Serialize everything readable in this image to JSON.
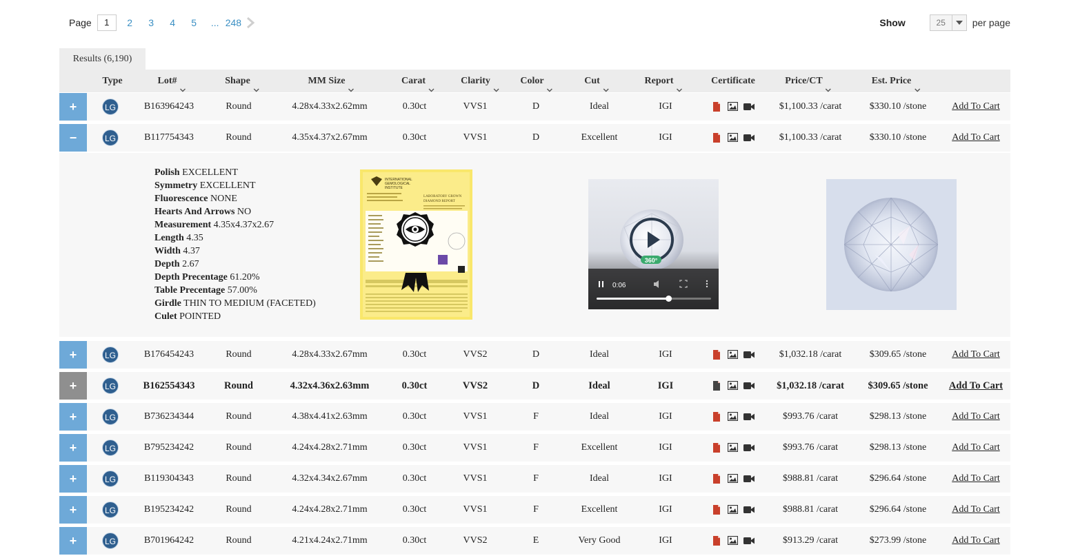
{
  "pagination": {
    "label": "Page",
    "current": "1",
    "pages": [
      "2",
      "3",
      "4",
      "5"
    ],
    "ellipsis": "...",
    "last": "248"
  },
  "show": {
    "label": "Show",
    "value": "25",
    "suffix": "per page"
  },
  "results_tab": "Results (6,190)",
  "columns": {
    "type": "Type",
    "lot": "Lot#",
    "shape": "Shape",
    "mm": "MM Size",
    "carat": "Carat",
    "clarity": "Clarity",
    "color": "Color",
    "cut": "Cut",
    "report": "Report",
    "certificate": "Certificate",
    "price_ct": "Price/CT",
    "est_price": "Est. Price"
  },
  "type_badge": "LG",
  "add_to_cart": "Add To Cart",
  "rows": [
    {
      "toggle": "+",
      "lot": "B163964243",
      "shape": "Round",
      "mm": "4.28x4.33x2.62mm",
      "carat": "0.30ct",
      "clarity": "VVS1",
      "color": "D",
      "cut": "Ideal",
      "report": "IGI",
      "price_ct": "$1,100.33 /carat",
      "est_price": "$330.10 /stone"
    },
    {
      "toggle": "−",
      "lot": "B117754343",
      "shape": "Round",
      "mm": "4.35x4.37x2.67mm",
      "carat": "0.30ct",
      "clarity": "VVS1",
      "color": "D",
      "cut": "Excellent",
      "report": "IGI",
      "price_ct": "$1,100.33 /carat",
      "est_price": "$330.10 /stone"
    },
    {
      "toggle": "+",
      "lot": "B176454243",
      "shape": "Round",
      "mm": "4.28x4.33x2.67mm",
      "carat": "0.30ct",
      "clarity": "VVS2",
      "color": "D",
      "cut": "Ideal",
      "report": "IGI",
      "price_ct": "$1,032.18 /carat",
      "est_price": "$309.65 /stone"
    },
    {
      "toggle": "+",
      "lot": "B162554343",
      "shape": "Round",
      "mm": "4.32x4.36x2.63mm",
      "carat": "0.30ct",
      "clarity": "VVS2",
      "color": "D",
      "cut": "Ideal",
      "report": "IGI",
      "price_ct": "$1,032.18 /carat",
      "est_price": "$309.65 /stone"
    },
    {
      "toggle": "+",
      "lot": "B736234344",
      "shape": "Round",
      "mm": "4.38x4.41x2.63mm",
      "carat": "0.30ct",
      "clarity": "VVS1",
      "color": "F",
      "cut": "Ideal",
      "report": "IGI",
      "price_ct": "$993.76 /carat",
      "est_price": "$298.13 /stone"
    },
    {
      "toggle": "+",
      "lot": "B795234242",
      "shape": "Round",
      "mm": "4.24x4.28x2.71mm",
      "carat": "0.30ct",
      "clarity": "VVS1",
      "color": "F",
      "cut": "Excellent",
      "report": "IGI",
      "price_ct": "$993.76 /carat",
      "est_price": "$298.13 /stone"
    },
    {
      "toggle": "+",
      "lot": "B119304343",
      "shape": "Round",
      "mm": "4.32x4.34x2.67mm",
      "carat": "0.30ct",
      "clarity": "VVS1",
      "color": "F",
      "cut": "Ideal",
      "report": "IGI",
      "price_ct": "$988.81 /carat",
      "est_price": "$296.64 /stone"
    },
    {
      "toggle": "+",
      "lot": "B195234242",
      "shape": "Round",
      "mm": "4.24x4.28x2.71mm",
      "carat": "0.30ct",
      "clarity": "VVS1",
      "color": "F",
      "cut": "Excellent",
      "report": "IGI",
      "price_ct": "$988.81 /carat",
      "est_price": "$296.64 /stone"
    },
    {
      "toggle": "+",
      "lot": "B701964242",
      "shape": "Round",
      "mm": "4.21x4.24x2.71mm",
      "carat": "0.30ct",
      "clarity": "VVS2",
      "color": "E",
      "cut": "Very Good",
      "report": "IGI",
      "price_ct": "$913.29 /carat",
      "est_price": "$273.99 /stone"
    }
  ],
  "detail": {
    "specs": [
      {
        "label": "Polish",
        "value": "EXCELLENT"
      },
      {
        "label": "Symmetry",
        "value": "EXCELLENT"
      },
      {
        "label": "Fluorescence",
        "value": "NONE"
      },
      {
        "label": "Hearts And Arrows",
        "value": "NO"
      },
      {
        "label": "Measurement",
        "value": "4.35x4.37x2.67"
      },
      {
        "label": "Length",
        "value": "4.35"
      },
      {
        "label": "Width",
        "value": "4.37"
      },
      {
        "label": "Depth",
        "value": "2.67"
      },
      {
        "label": "Depth Precentage",
        "value": "61.20%"
      },
      {
        "label": "Table Precentage",
        "value": "57.00%"
      },
      {
        "label": "Girdle",
        "value": "THIN TO MEDIUM (FACETED)"
      },
      {
        "label": "Culet",
        "value": "POINTED"
      }
    ],
    "certificate": {
      "org_line1": "INTERNATIONAL",
      "org_line2": "GEMOLOGICAL",
      "org_line3": "INSTITUTE",
      "report_line1": "LABORATORY GROWN",
      "report_line2": "DIAMOND REPORT"
    },
    "video": {
      "badge": "360°",
      "time": "0:06",
      "progress": 0.63
    }
  },
  "colors": {
    "toggle_blue": "#6ea9d8",
    "toggle_gray": "#8f8f8f",
    "badge_navy": "#2f5f8f",
    "link_blue": "#3a8fc3",
    "pdf_red": "#c9402b"
  }
}
